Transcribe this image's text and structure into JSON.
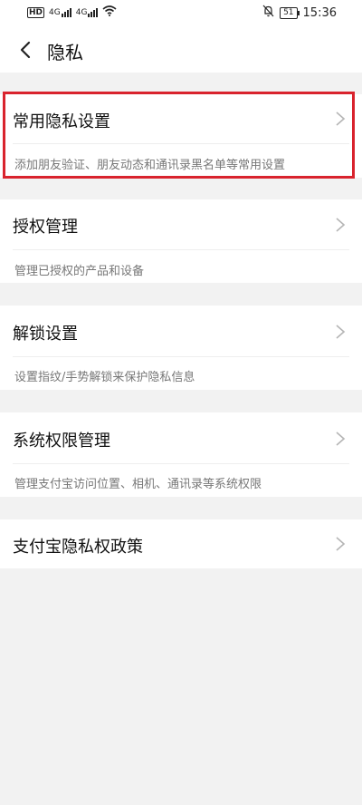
{
  "status_bar": {
    "left_badge": "HD",
    "net1": "4G",
    "net2": "4G",
    "battery": "51",
    "time": "15:36"
  },
  "header": {
    "title": "隐私"
  },
  "items": [
    {
      "label": "常用隐私设置",
      "desc": "添加朋友验证、朋友动态和通讯录黑名单等常用设置"
    },
    {
      "label": "授权管理",
      "desc": "管理已授权的产品和设备"
    },
    {
      "label": "解锁设置",
      "desc": "设置指纹/手势解锁来保护隐私信息"
    },
    {
      "label": "系统权限管理",
      "desc": "管理支付宝访问位置、相机、通讯录等系统权限"
    },
    {
      "label": "支付宝隐私权政策",
      "desc": ""
    }
  ],
  "colors": {
    "highlight_border": "#d9232d",
    "background": "#f2f2f2"
  },
  "icons": {
    "back": "chevron-left-icon",
    "row_arrow": "chevron-right-icon",
    "mute": "bell-off-icon",
    "wifi": "wifi-icon"
  }
}
